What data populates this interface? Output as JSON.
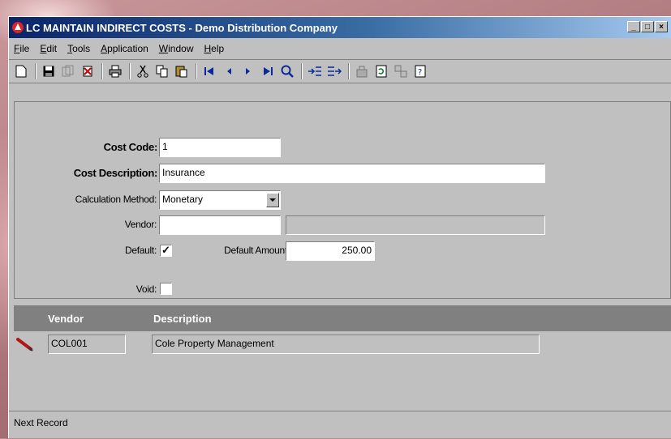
{
  "window": {
    "title": "LC MAINTAIN INDIRECT COSTS - Demo Distribution Company",
    "controls": [
      "_",
      "□",
      "×"
    ]
  },
  "menu": [
    "File",
    "Edit",
    "Tools",
    "Application",
    "Window",
    "Help"
  ],
  "toolbar": {
    "icons": [
      "new-icon",
      "save-icon",
      "copy-record-icon",
      "delete-icon",
      "print-icon",
      "cut-icon",
      "copy-icon",
      "paste-icon",
      "first-record-icon",
      "previous-record-icon",
      "next-record-icon",
      "last-record-icon",
      "find-icon",
      "insert-row-icon",
      "append-row-icon",
      "approve-icon",
      "refresh-icon",
      "link-icon",
      "help-icon"
    ]
  },
  "form": {
    "cost_code_label": "Cost Code:",
    "cost_code_value": "1",
    "cost_description_label": "Cost Description:",
    "cost_description_value": "Insurance",
    "calculation_method_label": "Calculation Method:",
    "calculation_method_value": "Monetary",
    "vendor_label": "Vendor:",
    "vendor_value": "",
    "vendor_name_value": "",
    "default_label": "Default:",
    "default_checked": "✓",
    "default_amount_label": "Default Amount:",
    "default_amount_value": "250.00",
    "void_label": "Void:",
    "void_checked": ""
  },
  "grid": {
    "columns": [
      "Vendor",
      "Description"
    ],
    "rows": [
      {
        "vendor": "COL001",
        "description": "Cole Property Management"
      }
    ]
  },
  "status": {
    "text": "Next Record"
  }
}
